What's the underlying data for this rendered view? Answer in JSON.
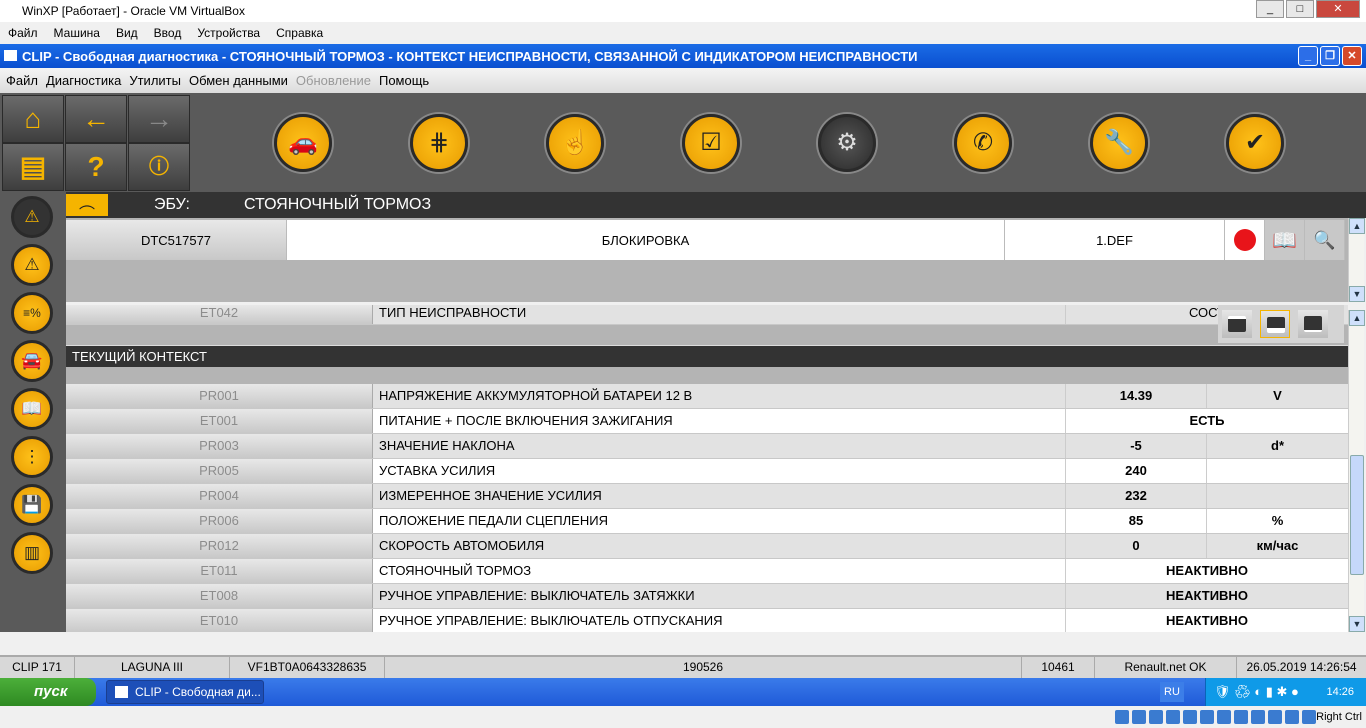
{
  "vbox": {
    "title": "WinXP [Работает] - Oracle VM VirtualBox",
    "menu": [
      "Файл",
      "Машина",
      "Вид",
      "Ввод",
      "Устройства",
      "Справка"
    ],
    "host_key": "Right Ctrl"
  },
  "clip": {
    "title": "CLIP - Свободная диагностика - СТОЯНОЧНЫЙ ТОРМОЗ - КОНТЕКСТ НЕИСПРАВНОСТИ, СВЯЗАННОЙ С ИНДИКАТОРОМ НЕИСПРАВНОСТИ",
    "menu": [
      {
        "label": "Файл",
        "disabled": false
      },
      {
        "label": "Диагностика",
        "disabled": false
      },
      {
        "label": "Утилиты",
        "disabled": false
      },
      {
        "label": "Обмен данными",
        "disabled": false
      },
      {
        "label": "Обновление",
        "disabled": true
      },
      {
        "label": "Помощь",
        "disabled": false
      }
    ]
  },
  "ecu": {
    "label": "ЭБУ:",
    "name": "СТОЯНОЧНЫЙ ТОРМОЗ"
  },
  "dtc": {
    "code": "DTC517577",
    "description": "БЛОКИРОВКА",
    "state": "1.DEF",
    "status_color": "#e8141a"
  },
  "partial_row": {
    "code": "ET042",
    "name": "ТИП НЕИСПРАВНОСТИ",
    "value": "СОСТ"
  },
  "context_title": "ТЕКУЩИЙ КОНТЕКСТ",
  "rows": [
    {
      "code": "PR001",
      "name": "НАПРЯЖЕНИЕ АККУМУЛЯТОРНОЙ БАТАРЕИ 12 В",
      "value": "14.39",
      "unit": "V"
    },
    {
      "code": "ET001",
      "name": "ПИТАНИЕ + ПОСЛЕ ВКЛЮЧЕНИЯ ЗАЖИГАНИЯ",
      "state": "ЕСТЬ"
    },
    {
      "code": "PR003",
      "name": "ЗНАЧЕНИЕ НАКЛОНА",
      "value": "-5",
      "unit": "d*"
    },
    {
      "code": "PR005",
      "name": "УСТАВКА УСИЛИЯ",
      "value": "240",
      "unit": ""
    },
    {
      "code": "PR004",
      "name": "ИЗМЕРЕННОЕ ЗНАЧЕНИЕ УСИЛИЯ",
      "value": "232",
      "unit": ""
    },
    {
      "code": "PR006",
      "name": "ПОЛОЖЕНИЕ ПЕДАЛИ СЦЕПЛЕНИЯ",
      "value": "85",
      "unit": "%"
    },
    {
      "code": "PR012",
      "name": "СКОРОСТЬ АВТОМОБИЛЯ",
      "value": "0",
      "unit": "км/час"
    },
    {
      "code": "ET011",
      "name": "СТОЯНОЧНЫЙ ТОРМОЗ",
      "state": "НЕАКТИВНО"
    },
    {
      "code": "ET008",
      "name": "РУЧНОЕ УПРАВЛЕНИЕ: ВЫКЛЮЧАТЕЛЬ ЗАТЯЖКИ",
      "state": "НЕАКТИВНО"
    },
    {
      "code": "ET010",
      "name": "РУЧНОЕ УПРАВЛЕНИЕ: ВЫКЛЮЧАТЕЛЬ ОТПУСКАНИЯ",
      "state": "НЕАКТИВНО"
    }
  ],
  "status": {
    "clip": "CLIP 171",
    "vehicle": "LAGUNA III",
    "vin": "VF1BT0A0643328635",
    "code": "190526",
    "num": "10461",
    "net": "Renault.net OK",
    "datetime": "26.05.2019 14:26:54"
  },
  "taskbar": {
    "start": "пуск",
    "task": "CLIP - Свободная ди...",
    "lang": "RU",
    "time": "14:26"
  }
}
